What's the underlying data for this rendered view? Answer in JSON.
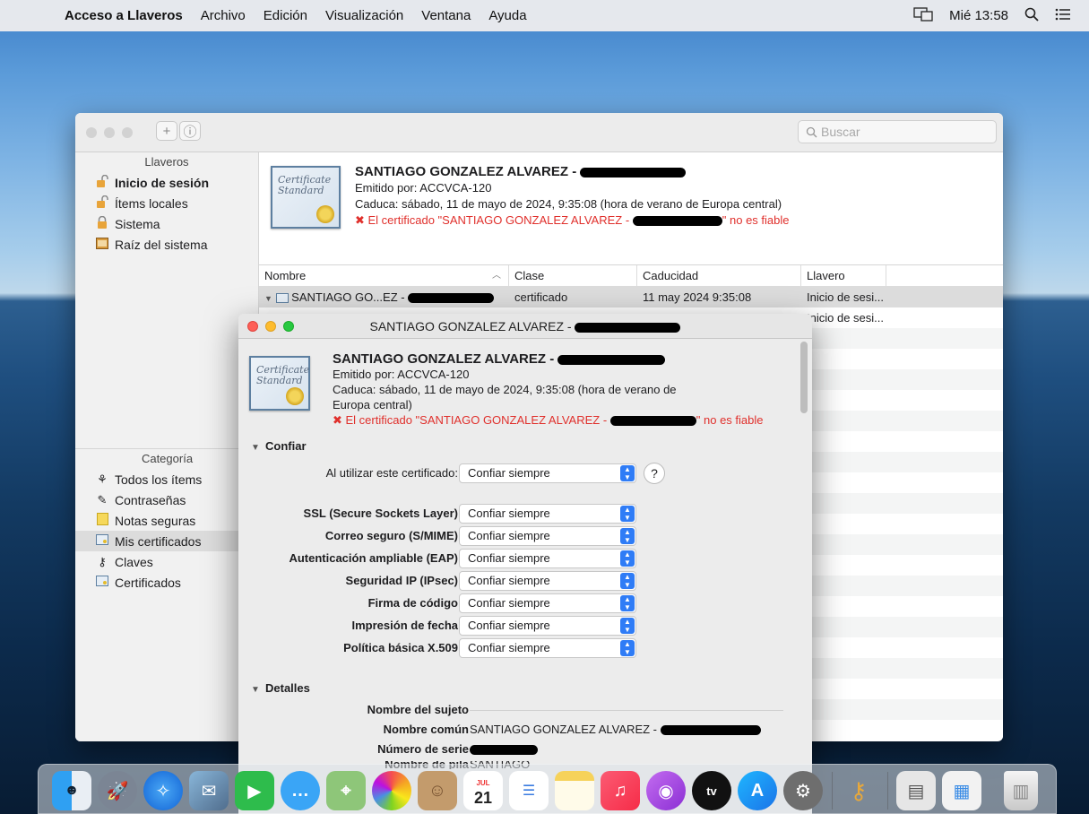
{
  "menubar": {
    "app": "Acceso a Llaveros",
    "items": [
      "Archivo",
      "Edición",
      "Visualización",
      "Ventana",
      "Ayuda"
    ],
    "clock": "Mié 13:58"
  },
  "window": {
    "search_placeholder": "Buscar",
    "sidebar": {
      "keychains_header": "Llaveros",
      "keychains": [
        "Inicio de sesión",
        "Ítems locales",
        "Sistema",
        "Raíz del sistema"
      ],
      "category_header": "Categoría",
      "categories": [
        "Todos los ítems",
        "Contraseñas",
        "Notas seguras",
        "Mis certificados",
        "Claves",
        "Certificados"
      ]
    },
    "info": {
      "cert_icon_text": "Certificate Standard",
      "name": "SANTIAGO GONZALEZ ALVAREZ -",
      "issuer": "Emitido por: ACCVCA-120",
      "expires": "Caduca: sábado, 11 de mayo de 2024, 9:35:08 (hora de verano de Europa central)",
      "warning_prefix": "✖ El certificado \"SANTIAGO GONZALEZ ALVAREZ -",
      "warning_suffix": "\" no es fiable"
    },
    "table": {
      "headers": [
        "Nombre",
        "Clase",
        "Caducidad",
        "Llavero"
      ],
      "rows": [
        {
          "name": "SANTIAGO GO...EZ -",
          "kind": "certificado",
          "expires": "11 may 2024 9:35:08",
          "keychain": "Inicio de sesi..."
        },
        {
          "name": "",
          "kind": "",
          "expires": "",
          "keychain": "Inicio de sesi..."
        }
      ]
    }
  },
  "dialog": {
    "title": "SANTIAGO GONZALEZ ALVAREZ -",
    "cert_icon_text": "Certificate Standard",
    "name": "SANTIAGO GONZALEZ ALVAREZ -",
    "issuer": "Emitido por: ACCVCA-120",
    "expires_line1": "Caduca: sábado, 11 de mayo de 2024, 9:35:08 (hora de verano de",
    "expires_line2": "Europa central)",
    "warning_prefix": "✖ El certificado \"SANTIAGO GONZALEZ ALVAREZ -",
    "warning_suffix": "\" no es fiable",
    "trust_section": "Confiar",
    "when_using_label": "Al utilizar este certificado:",
    "when_using_value": "Confiar siempre",
    "trust_rows": [
      {
        "label": "SSL (Secure Sockets Layer)",
        "value": "Confiar siempre"
      },
      {
        "label": "Correo seguro (S/MIME)",
        "value": "Confiar siempre"
      },
      {
        "label": "Autenticación ampliable (EAP)",
        "value": "Confiar siempre"
      },
      {
        "label": "Seguridad IP (IPsec)",
        "value": "Confiar siempre"
      },
      {
        "label": "Firma de código",
        "value": "Confiar siempre"
      },
      {
        "label": "Impresión de fecha",
        "value": "Confiar siempre"
      },
      {
        "label": "Política básica X.509",
        "value": "Confiar siempre"
      }
    ],
    "details_section": "Detalles",
    "subject_name": "Nombre del sujeto",
    "common_name_label": "Nombre común",
    "common_name_value": "SANTIAGO GONZALEZ ALVAREZ -",
    "serial_label": "Número de serie",
    "cut_label": "Nombre de pila",
    "cut_value": "SANTIAGO"
  },
  "dock": {
    "icons": [
      "finder-icon",
      "launchpad-icon",
      "safari-icon",
      "mail-icon",
      "facetime-icon",
      "messages-icon",
      "maps-icon",
      "photos-icon",
      "contacts-icon",
      "calendar-icon",
      "reminders-icon",
      "notes-icon",
      "music-icon",
      "podcasts-icon",
      "tv-icon",
      "app-store-icon",
      "system-preferences-icon",
      "keychain-access-icon",
      "documents-icon",
      "preview-icon",
      "trash-icon"
    ],
    "calendar_month": "JUL",
    "calendar_day": "21",
    "tv_label": "tv"
  }
}
